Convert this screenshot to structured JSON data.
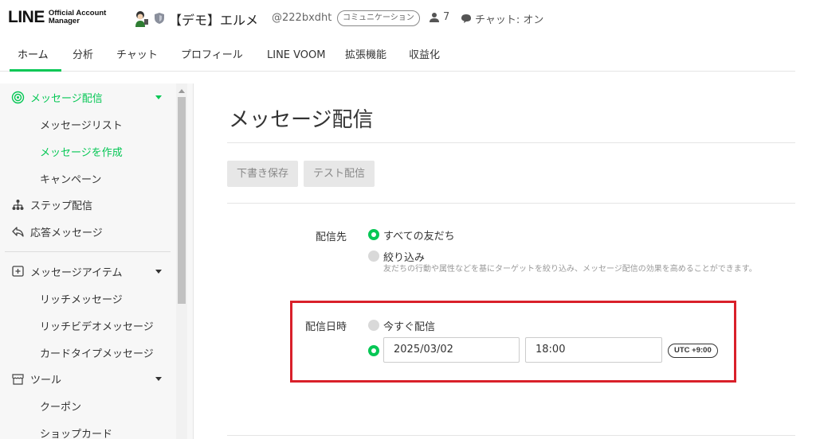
{
  "header": {
    "logo_main": "LINE",
    "logo_sub_line1": "Official Account",
    "logo_sub_line2": "Manager",
    "account_name": "【デモ】エルメ",
    "account_id": "@222bxdht",
    "account_type_badge": "コミュニケーション",
    "friend_count": "7",
    "chat_status": "チャット: オン"
  },
  "topnav": {
    "tabs": [
      {
        "label": "ホーム",
        "active": true
      },
      {
        "label": "分析"
      },
      {
        "label": "チャット"
      },
      {
        "label": "プロフィール"
      },
      {
        "label": "LINE VOOM"
      },
      {
        "label": "拡張機能"
      },
      {
        "label": "収益化"
      }
    ]
  },
  "sidebar": {
    "items": [
      {
        "label": "メッセージ配信",
        "icon": "broadcast-icon",
        "expanded": true
      },
      {
        "label": "メッセージリスト"
      },
      {
        "label": "メッセージを作成",
        "selected": true
      },
      {
        "label": "キャンペーン"
      },
      {
        "label": "ステップ配信",
        "icon": "hierarchy-icon"
      },
      {
        "label": "応答メッセージ",
        "icon": "reply-icon"
      },
      {
        "label": "メッセージアイテム",
        "icon": "plus-box-icon",
        "expanded": true
      },
      {
        "label": "リッチメッセージ"
      },
      {
        "label": "リッチビデオメッセージ"
      },
      {
        "label": "カードタイプメッセージ"
      },
      {
        "label": "ツール",
        "icon": "shop-icon",
        "expanded": true
      },
      {
        "label": "クーポン"
      },
      {
        "label": "ショップカード"
      }
    ]
  },
  "main": {
    "title": "メッセージ配信",
    "buttons": {
      "draft_save": "下書き保存",
      "test_send": "テスト配信"
    },
    "recipients": {
      "label": "配信先",
      "option_all": "すべての友だち",
      "option_filter": "絞り込み",
      "filter_hint": "友だちの行動や属性などを基にターゲットを絞り込み、メッセージ配信の効果を高めることができます。"
    },
    "schedule": {
      "label": "配信日時",
      "option_now": "今すぐ配信",
      "date": "2025/03/02",
      "time": "18:00",
      "timezone": "UTC +9:00"
    }
  },
  "colors": {
    "accent_green": "#06c755",
    "highlight_red": "#d9202a"
  }
}
